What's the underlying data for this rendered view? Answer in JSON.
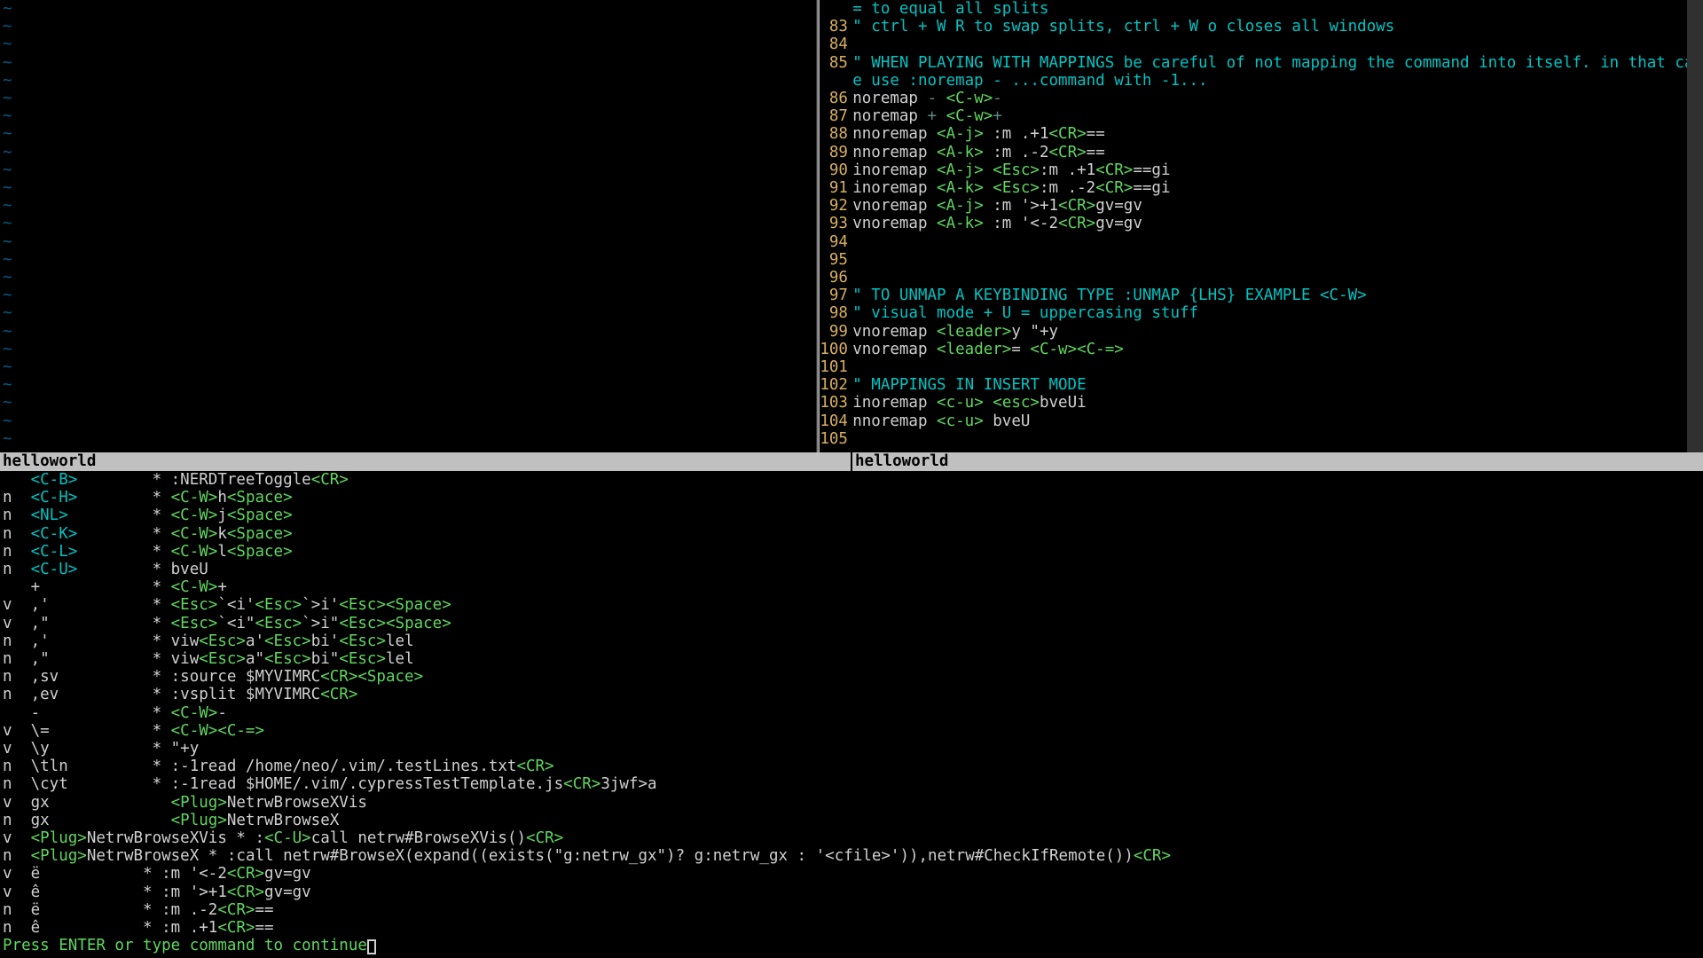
{
  "status": {
    "left": "helloworld",
    "right": "helloworld"
  },
  "prompt": "Press ENTER or type command to continue",
  "editor": {
    "lines": [
      {
        "num": "",
        "segs": [
          [
            "c-cyan",
            "= to equal all splits"
          ]
        ]
      },
      {
        "num": "83",
        "segs": [
          [
            "c-cyan",
            "\" ctrl + W R to swap splits, ctrl + W o closes all windows"
          ]
        ]
      },
      {
        "num": "84",
        "segs": []
      },
      {
        "num": "85",
        "segs": [
          [
            "c-cyan",
            "\" WHEN PLAYING WITH MAPPINGS be careful of not mapping the command into itself. in that cas"
          ]
        ]
      },
      {
        "num": "",
        "segs": [
          [
            "c-cyan",
            "e use :noremap - ...command with -1..."
          ]
        ]
      },
      {
        "num": "86",
        "segs": [
          [
            "c-white",
            "noremap "
          ],
          [
            "c-darkc",
            "-"
          ],
          [
            "c-white",
            " "
          ],
          [
            "c-green",
            "<C-w>"
          ],
          [
            "c-darkc",
            "-"
          ]
        ]
      },
      {
        "num": "87",
        "segs": [
          [
            "c-white",
            "noremap "
          ],
          [
            "c-darkc",
            "+"
          ],
          [
            "c-white",
            " "
          ],
          [
            "c-green",
            "<C-w>"
          ],
          [
            "c-darkc",
            "+"
          ]
        ]
      },
      {
        "num": "88",
        "segs": [
          [
            "c-white",
            "nnoremap "
          ],
          [
            "c-green",
            "<A-j>"
          ],
          [
            "c-white",
            " :m .+1"
          ],
          [
            "c-green",
            "<CR>"
          ],
          [
            "c-white",
            "=="
          ]
        ]
      },
      {
        "num": "89",
        "segs": [
          [
            "c-white",
            "nnoremap "
          ],
          [
            "c-green",
            "<A-k>"
          ],
          [
            "c-white",
            " :m .-2"
          ],
          [
            "c-green",
            "<CR>"
          ],
          [
            "c-white",
            "=="
          ]
        ]
      },
      {
        "num": "90",
        "segs": [
          [
            "c-white",
            "inoremap "
          ],
          [
            "c-green",
            "<A-j>"
          ],
          [
            "c-white",
            " "
          ],
          [
            "c-green",
            "<Esc>"
          ],
          [
            "c-white",
            ":m .+1"
          ],
          [
            "c-green",
            "<CR>"
          ],
          [
            "c-white",
            "==gi"
          ]
        ]
      },
      {
        "num": "91",
        "segs": [
          [
            "c-white",
            "inoremap "
          ],
          [
            "c-green",
            "<A-k>"
          ],
          [
            "c-white",
            " "
          ],
          [
            "c-green",
            "<Esc>"
          ],
          [
            "c-white",
            ":m .-2"
          ],
          [
            "c-green",
            "<CR>"
          ],
          [
            "c-white",
            "==gi"
          ]
        ]
      },
      {
        "num": "92",
        "segs": [
          [
            "c-white",
            "vnoremap "
          ],
          [
            "c-green",
            "<A-j>"
          ],
          [
            "c-white",
            " :m '>+1"
          ],
          [
            "c-green",
            "<CR>"
          ],
          [
            "c-white",
            "gv=gv"
          ]
        ]
      },
      {
        "num": "93",
        "segs": [
          [
            "c-white",
            "vnoremap "
          ],
          [
            "c-green",
            "<A-k>"
          ],
          [
            "c-white",
            " :m '<-2"
          ],
          [
            "c-green",
            "<CR>"
          ],
          [
            "c-white",
            "gv=gv"
          ]
        ]
      },
      {
        "num": "94",
        "segs": []
      },
      {
        "num": "95",
        "segs": []
      },
      {
        "num": "96",
        "segs": []
      },
      {
        "num": "97",
        "segs": [
          [
            "c-cyan",
            "\" TO UNMAP A KEYBINDING TYPE :UNMAP {LHS} EXAMPLE <C-W>"
          ]
        ]
      },
      {
        "num": "98",
        "segs": [
          [
            "c-cyan",
            "\" visual mode + U = uppercasing stuff"
          ]
        ]
      },
      {
        "num": "99",
        "segs": [
          [
            "c-white",
            "vnoremap "
          ],
          [
            "c-green",
            "<leader>"
          ],
          [
            "c-white",
            "y \"+y"
          ]
        ]
      },
      {
        "num": "100",
        "segs": [
          [
            "c-white",
            "vnoremap "
          ],
          [
            "c-green",
            "<leader>"
          ],
          [
            "c-white",
            "= "
          ],
          [
            "c-green",
            "<C-w><C-=>"
          ]
        ]
      },
      {
        "num": "101",
        "segs": []
      },
      {
        "num": "102",
        "segs": [
          [
            "c-cyan",
            "\" MAPPINGS IN INSERT MODE"
          ]
        ]
      },
      {
        "num": "103",
        "segs": [
          [
            "c-white",
            "inoremap "
          ],
          [
            "c-green",
            "<c-u>"
          ],
          [
            "c-white",
            " "
          ],
          [
            "c-green",
            "<esc>"
          ],
          [
            "c-white",
            "bveUi"
          ]
        ]
      },
      {
        "num": "104",
        "segs": [
          [
            "c-white",
            "nnoremap "
          ],
          [
            "c-green",
            "<c-u>"
          ],
          [
            "c-white",
            " bveU"
          ]
        ]
      },
      {
        "num": "105",
        "segs": []
      }
    ]
  },
  "tildeCount": 25,
  "mappings": [
    {
      "m": " ",
      "k": "<C-B>",
      "r": [
        [
          "c-white",
          "* :NERDTreeToggle"
        ],
        [
          "c-green",
          "<CR>"
        ]
      ]
    },
    {
      "m": "n",
      "k": "<C-H>",
      "r": [
        [
          "c-white",
          "* "
        ],
        [
          "c-green",
          "<C-W>"
        ],
        [
          "c-white",
          "h"
        ],
        [
          "c-green",
          "<Space>"
        ]
      ]
    },
    {
      "m": "n",
      "k": "<NL>",
      "r": [
        [
          "c-white",
          "* "
        ],
        [
          "c-green",
          "<C-W>"
        ],
        [
          "c-white",
          "j"
        ],
        [
          "c-green",
          "<Space>"
        ]
      ]
    },
    {
      "m": "n",
      "k": "<C-K>",
      "r": [
        [
          "c-white",
          "* "
        ],
        [
          "c-green",
          "<C-W>"
        ],
        [
          "c-white",
          "k"
        ],
        [
          "c-green",
          "<Space>"
        ]
      ]
    },
    {
      "m": "n",
      "k": "<C-L>",
      "r": [
        [
          "c-white",
          "* "
        ],
        [
          "c-green",
          "<C-W>"
        ],
        [
          "c-white",
          "l"
        ],
        [
          "c-green",
          "<Space>"
        ]
      ]
    },
    {
      "m": "n",
      "k": "<C-U>",
      "r": [
        [
          "c-white",
          "* bveU"
        ]
      ]
    },
    {
      "m": " ",
      "k": "+",
      "r": [
        [
          "c-white",
          "* "
        ],
        [
          "c-green",
          "<C-W>"
        ],
        [
          "c-white",
          "+"
        ]
      ],
      "plain": true
    },
    {
      "m": "v",
      "k": ",'",
      "r": [
        [
          "c-white",
          "* "
        ],
        [
          "c-green",
          "<Esc>"
        ],
        [
          "c-white",
          "`<i'"
        ],
        [
          "c-green",
          "<Esc>"
        ],
        [
          "c-white",
          "`>i'"
        ],
        [
          "c-green",
          "<Esc><Space>"
        ]
      ],
      "plain": true
    },
    {
      "m": "v",
      "k": ",\"",
      "r": [
        [
          "c-white",
          "* "
        ],
        [
          "c-green",
          "<Esc>"
        ],
        [
          "c-white",
          "`<i\""
        ],
        [
          "c-green",
          "<Esc>"
        ],
        [
          "c-white",
          "`>i\""
        ],
        [
          "c-green",
          "<Esc><Space>"
        ]
      ],
      "plain": true
    },
    {
      "m": "n",
      "k": ",'",
      "r": [
        [
          "c-white",
          "* viw"
        ],
        [
          "c-green",
          "<Esc>"
        ],
        [
          "c-white",
          "a'"
        ],
        [
          "c-green",
          "<Esc>"
        ],
        [
          "c-white",
          "bi'"
        ],
        [
          "c-green",
          "<Esc>"
        ],
        [
          "c-white",
          "lel"
        ]
      ],
      "plain": true
    },
    {
      "m": "n",
      "k": ",\"",
      "r": [
        [
          "c-white",
          "* viw"
        ],
        [
          "c-green",
          "<Esc>"
        ],
        [
          "c-white",
          "a\""
        ],
        [
          "c-green",
          "<Esc>"
        ],
        [
          "c-white",
          "bi\""
        ],
        [
          "c-green",
          "<Esc>"
        ],
        [
          "c-white",
          "lel"
        ]
      ],
      "plain": true
    },
    {
      "m": "n",
      "k": ",sv",
      "r": [
        [
          "c-white",
          "* :source $MYVIMRC"
        ],
        [
          "c-green",
          "<CR><Space>"
        ]
      ],
      "plain": true
    },
    {
      "m": "n",
      "k": ",ev",
      "r": [
        [
          "c-white",
          "* :vsplit $MYVIMRC"
        ],
        [
          "c-green",
          "<CR>"
        ]
      ],
      "plain": true
    },
    {
      "m": " ",
      "k": "-",
      "r": [
        [
          "c-white",
          "* "
        ],
        [
          "c-green",
          "<C-W>"
        ],
        [
          "c-white",
          "-"
        ]
      ],
      "plain": true
    },
    {
      "m": "v",
      "k": "\\=",
      "r": [
        [
          "c-white",
          "* "
        ],
        [
          "c-green",
          "<C-W><C-=>"
        ]
      ],
      "plain": true
    },
    {
      "m": "v",
      "k": "\\y",
      "r": [
        [
          "c-white",
          "* \"+y"
        ]
      ],
      "plain": true
    },
    {
      "m": "n",
      "k": "\\tln",
      "r": [
        [
          "c-white",
          "* :-1read /home/neo/.vim/.testLines.txt"
        ],
        [
          "c-green",
          "<CR>"
        ]
      ],
      "plain": true
    },
    {
      "m": "n",
      "k": "\\cyt",
      "r": [
        [
          "c-white",
          "* :-1read $HOME/.vim/.cypressTestTemplate.js"
        ],
        [
          "c-green",
          "<CR>"
        ],
        [
          "c-white",
          "3jwf>a"
        ]
      ],
      "plain": true
    },
    {
      "m": "v",
      "k": "gx",
      "r": [
        [
          "c-white",
          "  "
        ],
        [
          "c-green",
          "<Plug>"
        ],
        [
          "c-white",
          "NetrwBrowseXVis"
        ]
      ],
      "plain": true
    },
    {
      "m": "n",
      "k": "gx",
      "r": [
        [
          "c-white",
          "  "
        ],
        [
          "c-green",
          "<Plug>"
        ],
        [
          "c-white",
          "NetrwBrowseX"
        ]
      ],
      "plain": true
    }
  ],
  "mappingsFull": [
    {
      "m": "v",
      "segs": [
        [
          "c-green",
          "<Plug>"
        ],
        [
          "c-white",
          "NetrwBrowseXVis * :"
        ],
        [
          "c-green",
          "<C-U>"
        ],
        [
          "c-white",
          "call netrw#BrowseXVis()"
        ],
        [
          "c-green",
          "<CR>"
        ]
      ]
    },
    {
      "m": "n",
      "segs": [
        [
          "c-green",
          "<Plug>"
        ],
        [
          "c-white",
          "NetrwBrowseX * :call netrw#BrowseX(expand((exists(\"g:netrw_gx\")? g:netrw_gx : '<cfile>')),netrw#CheckIfRemote())"
        ],
        [
          "c-green",
          "<CR>"
        ]
      ]
    },
    {
      "m": "v",
      "segs": [
        [
          "c-white",
          "ë           * :m '<-2"
        ],
        [
          "c-green",
          "<CR>"
        ],
        [
          "c-white",
          "gv=gv"
        ]
      ]
    },
    {
      "m": "v",
      "segs": [
        [
          "c-white",
          "ê           * :m '>+1"
        ],
        [
          "c-green",
          "<CR>"
        ],
        [
          "c-white",
          "gv=gv"
        ]
      ]
    },
    {
      "m": "n",
      "segs": [
        [
          "c-white",
          "ë           * :m .-2"
        ],
        [
          "c-green",
          "<CR>"
        ],
        [
          "c-white",
          "=="
        ]
      ]
    },
    {
      "m": "n",
      "segs": [
        [
          "c-white",
          "ê           * :m .+1"
        ],
        [
          "c-green",
          "<CR>"
        ],
        [
          "c-white",
          "=="
        ]
      ]
    }
  ]
}
